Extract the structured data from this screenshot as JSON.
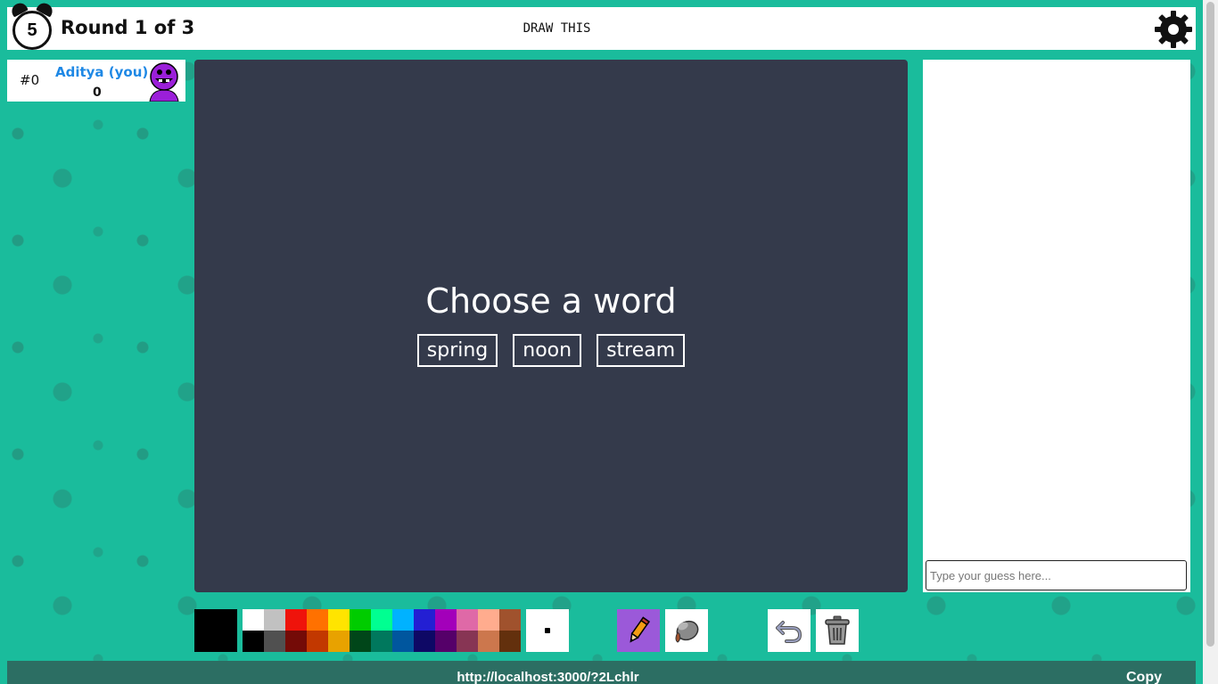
{
  "header": {
    "timer": "5",
    "round": "Round 1 of 3",
    "word_hint": "DRAW THIS"
  },
  "players": [
    {
      "rank": "#0",
      "name": "Aditya (you)",
      "score": "0"
    }
  ],
  "canvas": {
    "title": "Choose a word",
    "words": [
      "spring",
      "noon",
      "stream"
    ]
  },
  "chat": {
    "placeholder": "Type your guess here..."
  },
  "toolbar": {
    "current_color": "#000000",
    "palette_top": [
      "#ffffff",
      "#c1c1c1",
      "#ef130b",
      "#ff7100",
      "#ffe400",
      "#00cc00",
      "#00ff91",
      "#00b2ff",
      "#231fd3",
      "#a300ba",
      "#df69a7",
      "#ffac8e",
      "#a0522d"
    ],
    "palette_bottom": [
      "#000000",
      "#505050",
      "#740b07",
      "#c23800",
      "#e8a200",
      "#004619",
      "#00785d",
      "#00569e",
      "#0e0865",
      "#550069",
      "#873554",
      "#cc774d",
      "#63300d"
    ],
    "tools": [
      "pencil-icon",
      "fill-bucket-icon",
      "undo-icon",
      "trash-icon"
    ]
  },
  "footer": {
    "invite_url": "http://localhost:3000/?2Lchlr",
    "copy_label": "Copy"
  },
  "colors": {
    "background": "#1abc9c",
    "canvas": "#343a4b",
    "player_name": "#1e88e5",
    "active_tool": "#9b59d9",
    "footer": "#2c6e63"
  }
}
